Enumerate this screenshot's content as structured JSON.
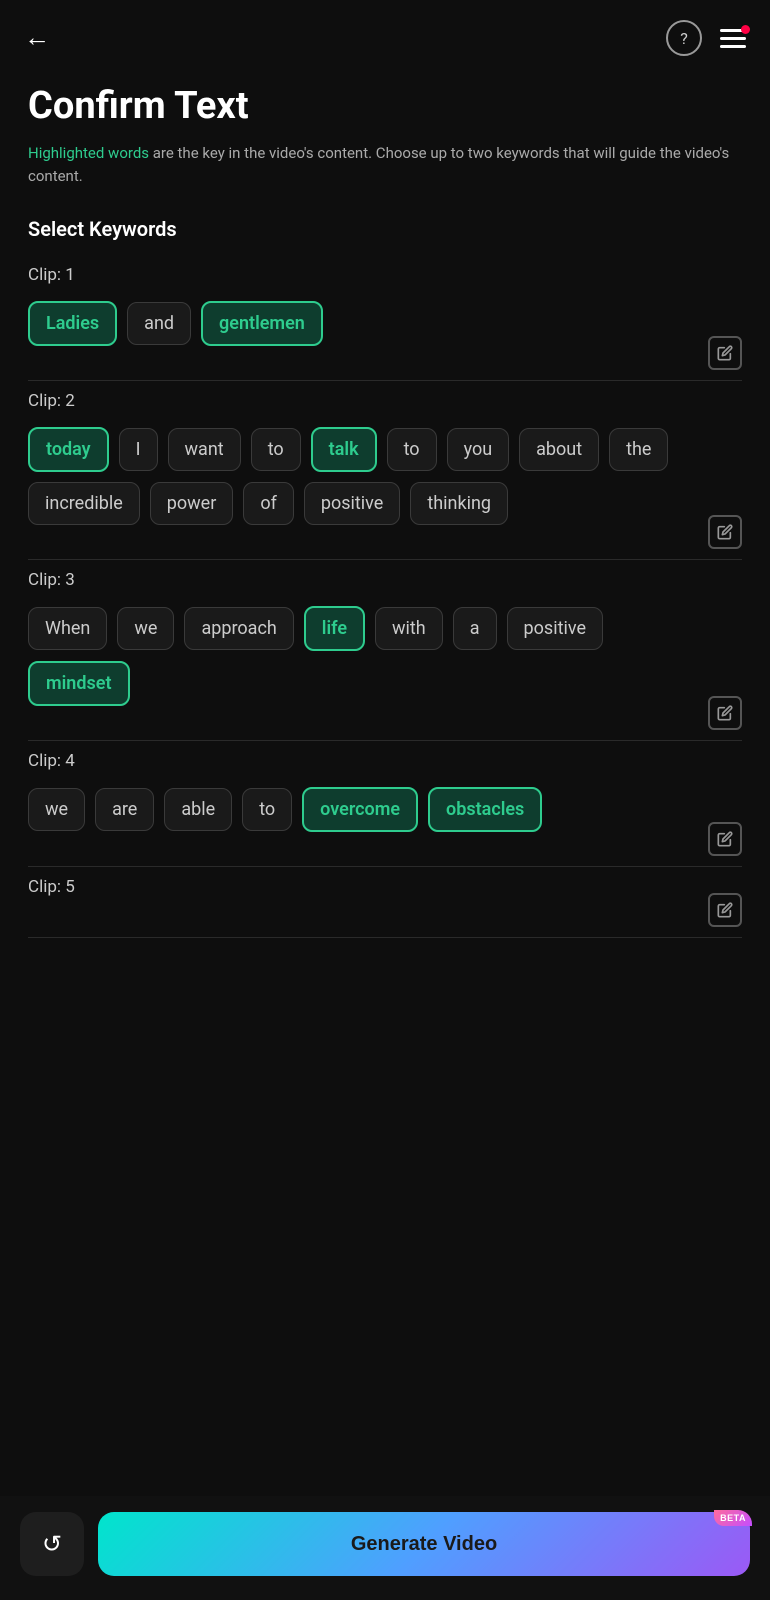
{
  "header": {
    "back_label": "←",
    "help_label": "?",
    "title": "Confirm Text"
  },
  "description": {
    "highlighted_text": "Highlighted words",
    "rest_text": " are the key in the video's content. Choose up to two keywords that will guide the video's content."
  },
  "select_keywords_label": "Select Keywords",
  "clips": [
    {
      "label": "Clip: 1",
      "words": [
        {
          "text": "Ladies",
          "selected": true
        },
        {
          "text": "and",
          "selected": false
        },
        {
          "text": "gentlemen",
          "selected": true
        }
      ]
    },
    {
      "label": "Clip: 2",
      "words": [
        {
          "text": "today",
          "selected": true
        },
        {
          "text": "I",
          "selected": false
        },
        {
          "text": "want",
          "selected": false
        },
        {
          "text": "to",
          "selected": false
        },
        {
          "text": "talk",
          "selected": true
        },
        {
          "text": "to",
          "selected": false
        },
        {
          "text": "you",
          "selected": false
        },
        {
          "text": "about",
          "selected": false
        },
        {
          "text": "the",
          "selected": false
        },
        {
          "text": "incredible",
          "selected": false
        },
        {
          "text": "power",
          "selected": false
        },
        {
          "text": "of",
          "selected": false
        },
        {
          "text": "positive",
          "selected": false
        },
        {
          "text": "thinking",
          "selected": false
        }
      ]
    },
    {
      "label": "Clip: 3",
      "words": [
        {
          "text": "When",
          "selected": false
        },
        {
          "text": "we",
          "selected": false
        },
        {
          "text": "approach",
          "selected": false
        },
        {
          "text": "life",
          "selected": true
        },
        {
          "text": "with",
          "selected": false
        },
        {
          "text": "a",
          "selected": false
        },
        {
          "text": "positive",
          "selected": false
        },
        {
          "text": "mindset",
          "selected": true
        }
      ]
    },
    {
      "label": "Clip: 4",
      "words": [
        {
          "text": "we",
          "selected": false
        },
        {
          "text": "are",
          "selected": false
        },
        {
          "text": "able",
          "selected": false
        },
        {
          "text": "to",
          "selected": false
        },
        {
          "text": "overcome",
          "selected": true
        },
        {
          "text": "obstacles",
          "selected": true
        }
      ]
    },
    {
      "label": "Clip: 5",
      "words": []
    }
  ],
  "bottom_bar": {
    "reset_icon": "↺",
    "generate_label": "Generate Video",
    "beta_label": "BETA"
  }
}
